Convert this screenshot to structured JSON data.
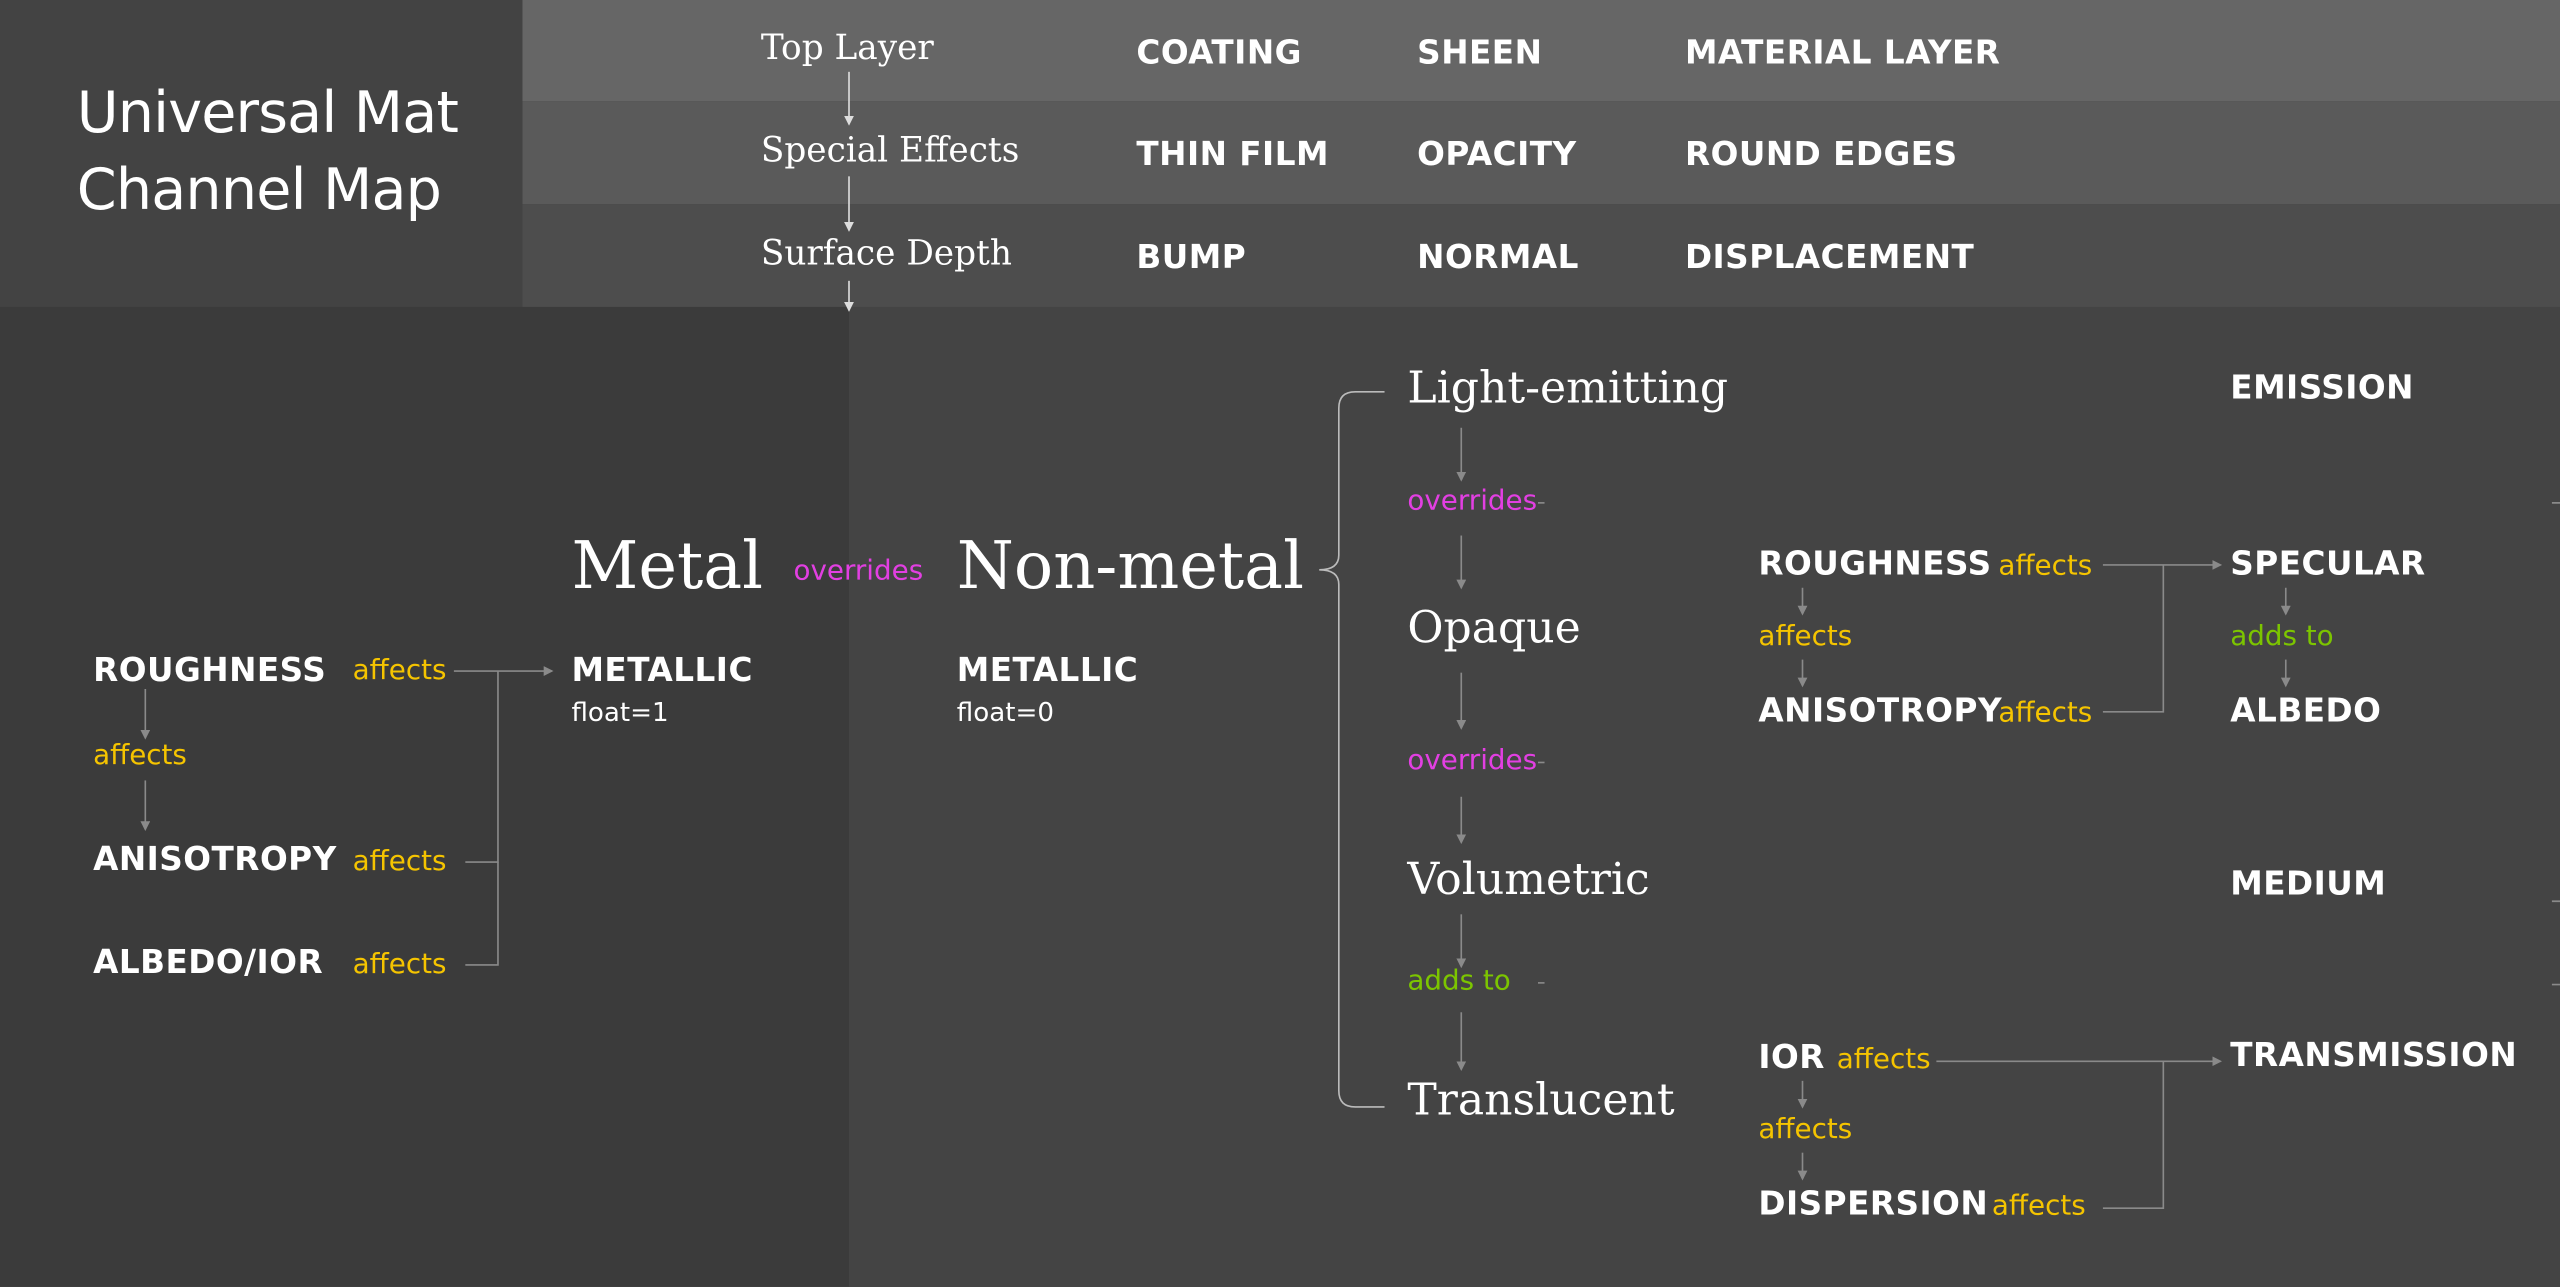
{
  "title": {
    "line1": "Universal Mat",
    "line2": "Channel Map"
  },
  "layers": [
    {
      "label": "Top Layer",
      "channels": [
        "COATING",
        "SHEEN",
        "MATERIAL LAYER"
      ]
    },
    {
      "label": "Special Effects",
      "channels": [
        "THIN FILM",
        "OPACITY",
        "ROUND EDGES"
      ]
    },
    {
      "label": "Surface Depth",
      "channels": [
        "BUMP",
        "NORMAL",
        "DISPLACEMENT"
      ]
    }
  ],
  "metal_section": {
    "roughness": "ROUGHNESS",
    "roughness_rel": "affects",
    "between_rel": "affects",
    "anisotropy": "ANISOTROPY",
    "anisotropy_rel": "affects",
    "albedo_ior": "ALBEDO/IOR",
    "albedo_ior_rel": "affects",
    "metal": "Metal",
    "overrides": "overrides",
    "nonmetal": "Non-metal",
    "metal_channel": "METALLIC",
    "metal_value": "float=1",
    "nonmetal_channel": "METALLIC",
    "nonmetal_value": "float=0"
  },
  "types": [
    {
      "label": "Light-emitting"
    },
    {
      "label": "Opaque"
    },
    {
      "label": "Volumetric"
    },
    {
      "label": "Translucent"
    }
  ],
  "type_relations": [
    "overrides",
    "overrides",
    "adds to"
  ],
  "opaque_detail": {
    "roughness": "ROUGHNESS",
    "roughness_rel": "affects",
    "between_rel": "affects",
    "anisotropy": "ANISOTROPY",
    "anisotropy_rel": "affects",
    "specular": "SPECULAR",
    "adds_to": "adds to",
    "albedo": "ALBEDO"
  },
  "emission": "EMISSION",
  "medium": "MEDIUM",
  "translucent_detail": {
    "ior": "IOR",
    "ior_rel": "affects",
    "between_rel": "affects",
    "dispersion": "DISPERSION",
    "dispersion_rel": "affects",
    "transmission": "TRANSMISSION"
  },
  "colors": {
    "affects": "#f5c400",
    "overrides": "#e23fe2",
    "adds_to": "#7cc500",
    "lines": "#8a8a8a"
  }
}
